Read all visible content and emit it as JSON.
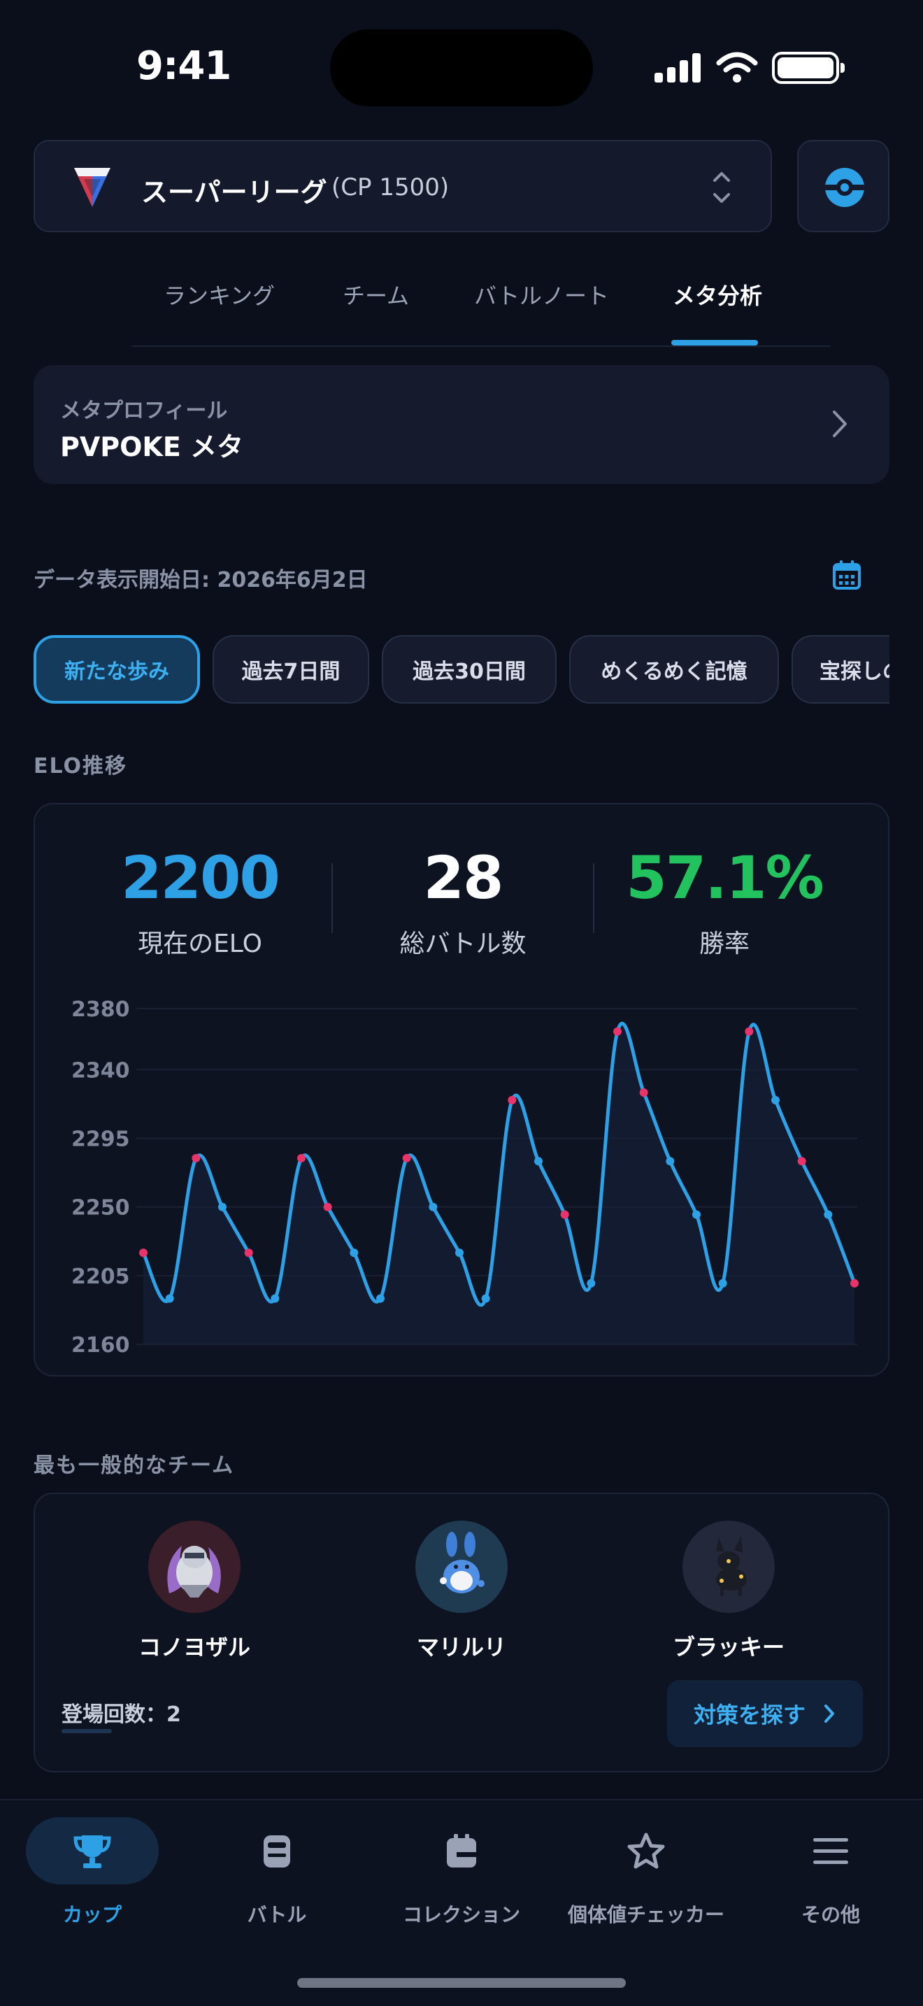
{
  "status": {
    "time": "9:41"
  },
  "league": {
    "name": "スーパーリーグ",
    "cp": "(CP 1500)"
  },
  "tabs": [
    {
      "label": "ランキング"
    },
    {
      "label": "チーム"
    },
    {
      "label": "バトルノート"
    },
    {
      "label": "メタ分析",
      "active": true
    }
  ],
  "meta": {
    "label": "メタプロフィール",
    "value": "PVPOKE メタ"
  },
  "date": {
    "text": "データ表示開始日: 2026年6月2日"
  },
  "filters": [
    {
      "label": "新たな歩み",
      "active": true
    },
    {
      "label": "過去7日間"
    },
    {
      "label": "過去30日間"
    },
    {
      "label": "めくるめく記憶"
    },
    {
      "label": "宝探しの"
    }
  ],
  "elo_section": {
    "title": "ELO推移"
  },
  "stats": {
    "elo": {
      "value": "2200",
      "label": "現在のELO",
      "color": "#2ea1e6"
    },
    "battles": {
      "value": "28",
      "label": "総バトル数",
      "color": "#ffffff"
    },
    "winrate": {
      "value": "57.1%",
      "label": "勝率",
      "color": "#22c35e"
    }
  },
  "chart_data": {
    "type": "line",
    "yticks": [
      "2380",
      "2340",
      "2295",
      "2250",
      "2205",
      "2160"
    ],
    "ylim": [
      2160,
      2380
    ],
    "grid": true,
    "line_color": "#2ea1e6",
    "marker_color": "#e8336b",
    "x": [
      1,
      2,
      3,
      4,
      5,
      6,
      7,
      8,
      9,
      10,
      11,
      12,
      13,
      14,
      15,
      16,
      17,
      18,
      19,
      20,
      21,
      22,
      23,
      24,
      25,
      26,
      27,
      28
    ],
    "series": [
      {
        "values": [
          2220,
          2190,
          2282,
          2250,
          2220,
          2190,
          2282,
          2250,
          2220,
          2190,
          2282,
          2250,
          2220,
          2190,
          2320,
          2280,
          2245,
          2200,
          2365,
          2325,
          2280,
          2245,
          2200,
          2365,
          2320,
          2280,
          2245,
          2200
        ]
      }
    ]
  },
  "team_section": {
    "title": "最も一般的なチーム"
  },
  "team": {
    "members": [
      {
        "name": "コノヨザル",
        "icon": "annihilape-sprite",
        "bg": "#3a1e2a"
      },
      {
        "name": "マリルリ",
        "icon": "azumarill-sprite",
        "bg": "#1f3b52"
      },
      {
        "name": "ブラッキー",
        "icon": "umbreon-sprite",
        "bg": "#23283a"
      }
    ],
    "appearances": "登場回数：2",
    "counter_button": "対策を探す"
  },
  "nav": [
    {
      "label": "カップ",
      "icon": "trophy-icon",
      "active": true
    },
    {
      "label": "バトル",
      "icon": "battle-icon"
    },
    {
      "label": "コレクション",
      "icon": "collection-icon"
    },
    {
      "label": "個体値チェッカー",
      "icon": "star-icon"
    },
    {
      "label": "その他",
      "icon": "menu-icon"
    }
  ]
}
